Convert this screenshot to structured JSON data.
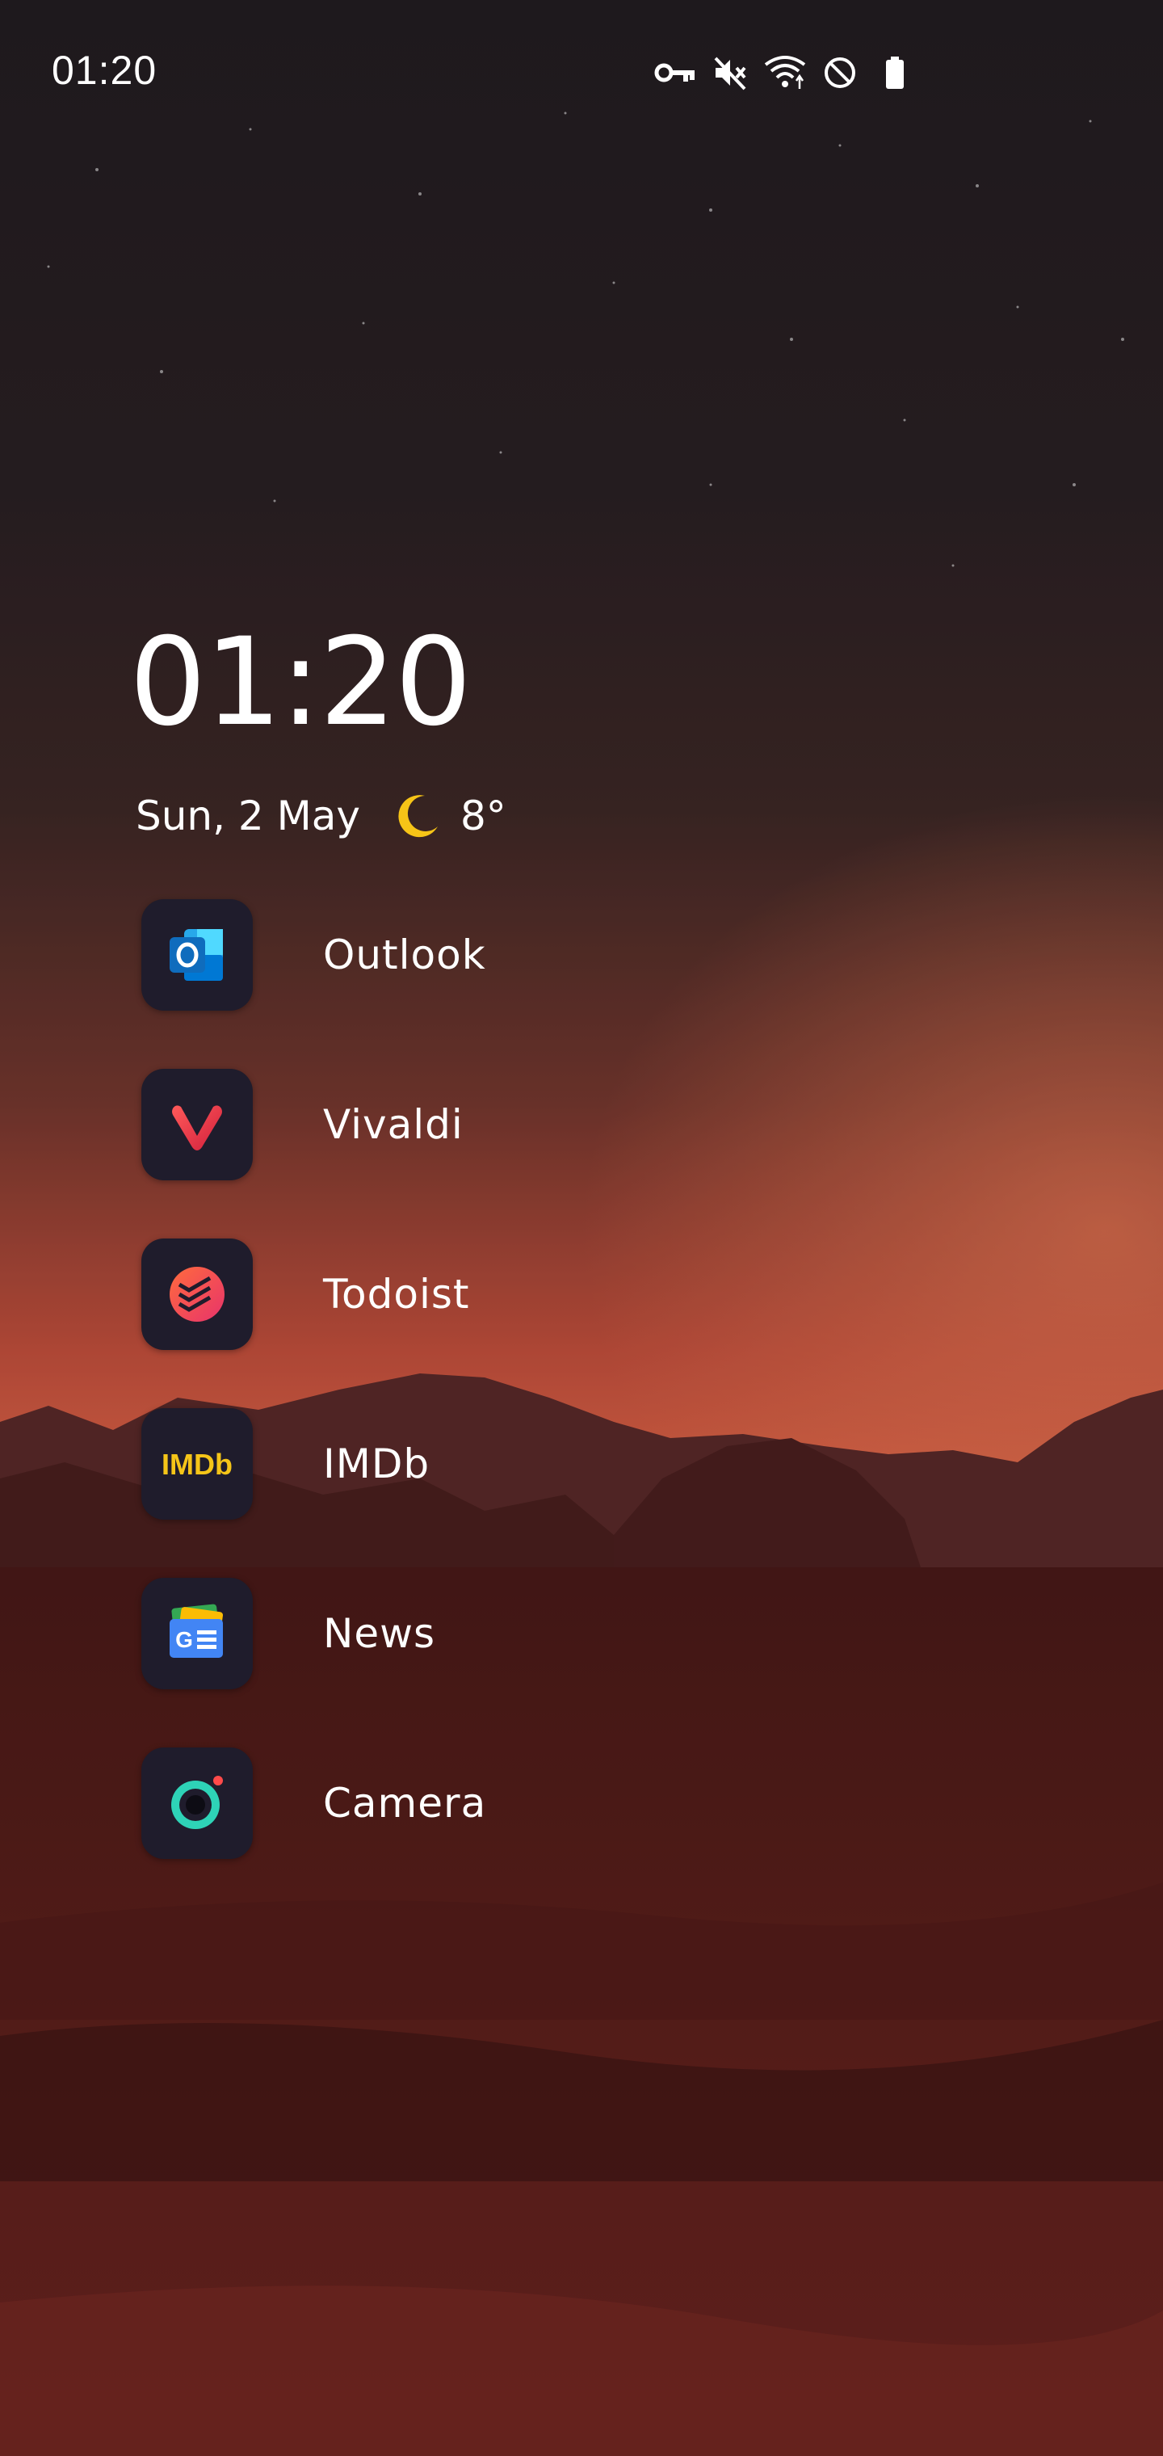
{
  "status_bar": {
    "time": "01:20",
    "icons": [
      "vpn-key-icon",
      "mute-icon",
      "wifi-icon",
      "do-not-disturb-icon",
      "battery-icon"
    ]
  },
  "clock_widget": {
    "time": "01:20",
    "date": "Sun, 2 May",
    "weather_icon": "moon-icon",
    "temperature": "8°"
  },
  "apps": [
    {
      "label": "Outlook",
      "icon": "outlook-icon",
      "color": "#0F6CBD"
    },
    {
      "label": "Vivaldi",
      "icon": "vivaldi-icon",
      "color": "#EF3939"
    },
    {
      "label": "Todoist",
      "icon": "todoist-icon",
      "color": "#E44332"
    },
    {
      "label": "IMDb",
      "icon": "imdb-icon",
      "color": "#F5C518"
    },
    {
      "label": "News",
      "icon": "google-news-icon",
      "color": "#4285F4"
    },
    {
      "label": "Camera",
      "icon": "camera-icon",
      "color": "#2ED3B7"
    }
  ],
  "colors": {
    "sky_top": "#241d22",
    "horizon_glow": "#e3664a",
    "desert": "#5a1e1c",
    "icon_background": "#1f1c2c",
    "moon": "#F6C417"
  }
}
